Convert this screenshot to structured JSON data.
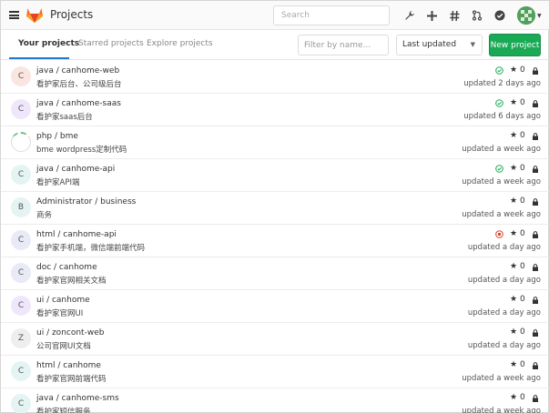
{
  "header": {
    "title": "Projects",
    "search_placeholder": "Search",
    "icons": [
      "menu-icon",
      "gitlab-logo",
      "wrench-icon",
      "plus-icon",
      "hash-icon",
      "merge-request-icon",
      "todo-check-icon",
      "user-avatar"
    ]
  },
  "tabs": {
    "items": [
      "Your projects",
      "Starred projects",
      "Explore projects"
    ],
    "filter_placeholder": "Filter by name...",
    "sort_value": "Last updated",
    "new_project_label": "New project",
    "new_project_color": "#1aaa55"
  },
  "projects": [
    {
      "letter": "C",
      "avatar_color": "#fbe5e1",
      "name": "java / canhome-web",
      "desc": "看护家后台、公司级后台",
      "status": "success",
      "stars": "0",
      "updated": "updated 2 days ago"
    },
    {
      "letter": "C",
      "avatar_color": "#f0e6fb",
      "name": "java / canhome-saas",
      "desc": "看护家saas后台",
      "status": "success",
      "stars": "0",
      "updated": "updated 6 days ago"
    },
    {
      "letter": "",
      "avatar_color": "#ffffff",
      "name": "php / bme",
      "desc": "bme wordpress定制代码",
      "status": "none",
      "stars": "0",
      "updated": "updated a week ago"
    },
    {
      "letter": "C",
      "avatar_color": "#e4f4f3",
      "name": "java / canhome-api",
      "desc": "看护家API端",
      "status": "success",
      "stars": "0",
      "updated": "updated a week ago"
    },
    {
      "letter": "B",
      "avatar_color": "#e4f4f3",
      "name": "Administrator / business",
      "desc": "商务",
      "status": "none",
      "stars": "0",
      "updated": "updated a week ago"
    },
    {
      "letter": "C",
      "avatar_color": "#e8eaf6",
      "name": "html / canhome-api",
      "desc": "看护家手机端，微信端前端代码",
      "status": "failed",
      "stars": "0",
      "updated": "updated a day ago"
    },
    {
      "letter": "C",
      "avatar_color": "#e8eaf6",
      "name": "doc / canhome",
      "desc": "看护家官网相关文档",
      "status": "none",
      "stars": "0",
      "updated": "updated a day ago"
    },
    {
      "letter": "C",
      "avatar_color": "#f0e6fb",
      "name": "ui / canhome",
      "desc": "看护家官网UI",
      "status": "none",
      "stars": "0",
      "updated": "updated a day ago"
    },
    {
      "letter": "Z",
      "avatar_color": "#eeeeee",
      "name": "ui / zoncont-web",
      "desc": "公司官网UI文档",
      "status": "none",
      "stars": "0",
      "updated": "updated a day ago"
    },
    {
      "letter": "C",
      "avatar_color": "#e4f4f3",
      "name": "html / canhome",
      "desc": "看护家官网前端代码",
      "status": "none",
      "stars": "0",
      "updated": "updated a week ago"
    },
    {
      "letter": "C",
      "avatar_color": "#e4f4f3",
      "name": "java / canhome-sms",
      "desc": "看护家短信服务",
      "status": "none",
      "stars": "0",
      "updated": "updated a week ago"
    }
  ]
}
